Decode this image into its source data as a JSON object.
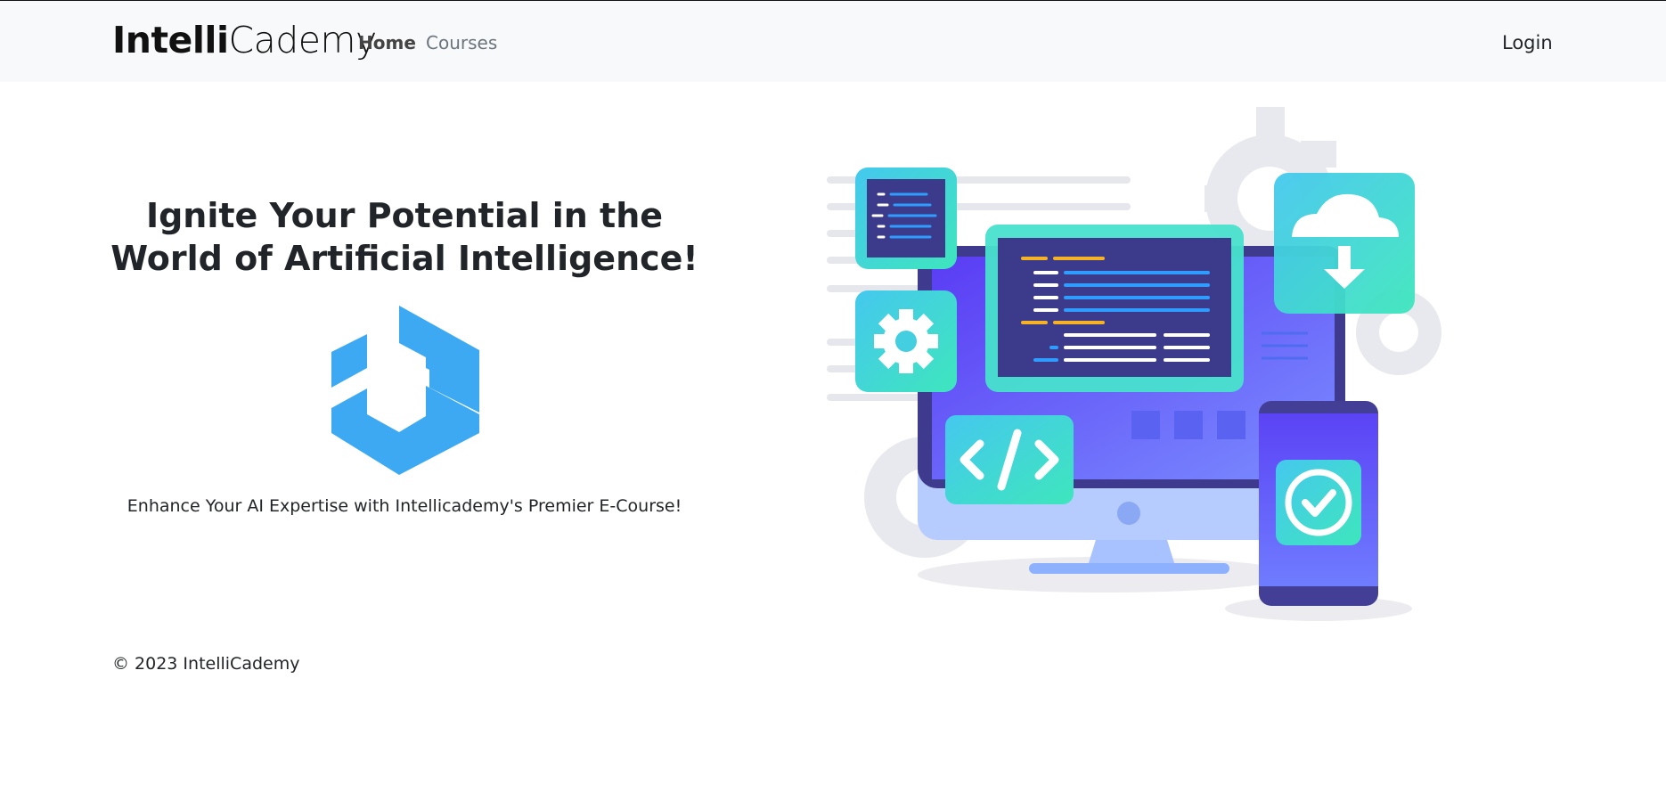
{
  "navbar": {
    "brand_bold": "Intelli",
    "brand_light": "Cademy",
    "links": [
      {
        "label": "Home",
        "active": true
      },
      {
        "label": "Courses",
        "active": false
      }
    ],
    "login_label": "Login"
  },
  "hero": {
    "title": "Ignite Your Potential in the World of Artificial Intelligence!",
    "tagline": "Enhance Your AI Expertise with Intellicademy's Premier E-Course!",
    "logo_icon": "intellicademy-hexagon-logo",
    "illustration": "coding-devices-illustration"
  },
  "footer": {
    "copyright": "© 2023 IntelliCademy"
  },
  "colors": {
    "navbar_bg": "#f8f9fa",
    "logo_blue": "#3ca9f2",
    "monitor_purple": "#5b4ef6",
    "teal": "#3fe0c0",
    "gear_gray": "#e6e7ec"
  }
}
